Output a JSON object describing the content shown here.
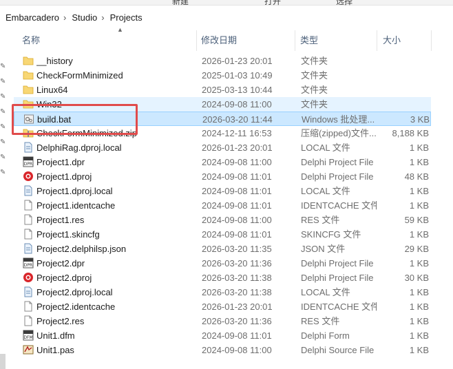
{
  "breadcrumb": [
    "Embarcadero",
    "Studio",
    "Projects"
  ],
  "ribbon_partial": [
    "新建",
    "打开",
    "选择"
  ],
  "columns": {
    "name": "名称",
    "date": "修改日期",
    "type": "类型",
    "size": "大小"
  },
  "files": [
    {
      "name": "__history",
      "date": "2026-01-23 20:01",
      "type": "文件夹",
      "size": "",
      "icon": "folder-icon"
    },
    {
      "name": "CheckFormMinimized",
      "date": "2025-01-03 10:49",
      "type": "文件夹",
      "size": "",
      "icon": "folder-icon"
    },
    {
      "name": "Linux64",
      "date": "2025-03-13 10:44",
      "type": "文件夹",
      "size": "",
      "icon": "folder-icon"
    },
    {
      "name": "Win32",
      "date": "2024-09-08 11:00",
      "type": "文件夹",
      "size": "",
      "icon": "folder-icon"
    },
    {
      "name": "build.bat",
      "date": "2026-03-20 11:44",
      "type": "Windows 批处理...",
      "size": "3 KB",
      "icon": "batch-file-icon"
    },
    {
      "name": "CheckFormMinimized.zip",
      "date": "2024-12-11 16:53",
      "type": "压缩(zipped)文件...",
      "size": "8,188 KB",
      "icon": "zip-folder-icon"
    },
    {
      "name": "DelphiRag.dproj.local",
      "date": "2026-01-23 20:01",
      "type": "LOCAL 文件",
      "size": "1 KB",
      "icon": "local-file-icon"
    },
    {
      "name": "Project1.dpr",
      "date": "2024-09-08 11:00",
      "type": "Delphi Project File",
      "size": "1 KB",
      "icon": "dpr-file-icon"
    },
    {
      "name": "Project1.dproj",
      "date": "2024-09-08 11:01",
      "type": "Delphi Project File",
      "size": "48 KB",
      "icon": "dproj-file-icon"
    },
    {
      "name": "Project1.dproj.local",
      "date": "2024-09-08 11:01",
      "type": "LOCAL 文件",
      "size": "1 KB",
      "icon": "local-file-icon"
    },
    {
      "name": "Project1.identcache",
      "date": "2024-09-08 11:01",
      "type": "IDENTCACHE 文件",
      "size": "1 KB",
      "icon": "blank-file-icon"
    },
    {
      "name": "Project1.res",
      "date": "2024-09-08 11:00",
      "type": "RES 文件",
      "size": "59 KB",
      "icon": "blank-file-icon"
    },
    {
      "name": "Project1.skincfg",
      "date": "2024-09-08 11:01",
      "type": "SKINCFG 文件",
      "size": "1 KB",
      "icon": "blank-file-icon"
    },
    {
      "name": "Project2.delphilsp.json",
      "date": "2026-03-20 11:35",
      "type": "JSON 文件",
      "size": "29 KB",
      "icon": "local-file-icon"
    },
    {
      "name": "Project2.dpr",
      "date": "2026-03-20 11:36",
      "type": "Delphi Project File",
      "size": "1 KB",
      "icon": "dpr-file-icon"
    },
    {
      "name": "Project2.dproj",
      "date": "2026-03-20 11:38",
      "type": "Delphi Project File",
      "size": "30 KB",
      "icon": "dproj-file-icon"
    },
    {
      "name": "Project2.dproj.local",
      "date": "2026-03-20 11:38",
      "type": "LOCAL 文件",
      "size": "1 KB",
      "icon": "local-file-icon"
    },
    {
      "name": "Project2.identcache",
      "date": "2026-01-23 20:01",
      "type": "IDENTCACHE 文件",
      "size": "1 KB",
      "icon": "blank-file-icon"
    },
    {
      "name": "Project2.res",
      "date": "2026-03-20 11:36",
      "type": "RES 文件",
      "size": "1 KB",
      "icon": "blank-file-icon"
    },
    {
      "name": "Unit1.dfm",
      "date": "2024-09-08 11:01",
      "type": "Delphi Form",
      "size": "1 KB",
      "icon": "dfm-file-icon"
    },
    {
      "name": "Unit1.pas",
      "date": "2024-09-08 11:00",
      "type": "Delphi Source File",
      "size": "1 KB",
      "icon": "pas-file-icon"
    }
  ],
  "colors": {
    "selection": "#cce8ff",
    "hover": "#e5f3ff",
    "folder": "#f8d775",
    "highlight_box": "#e04b4b",
    "header_text": "#4c607a"
  }
}
